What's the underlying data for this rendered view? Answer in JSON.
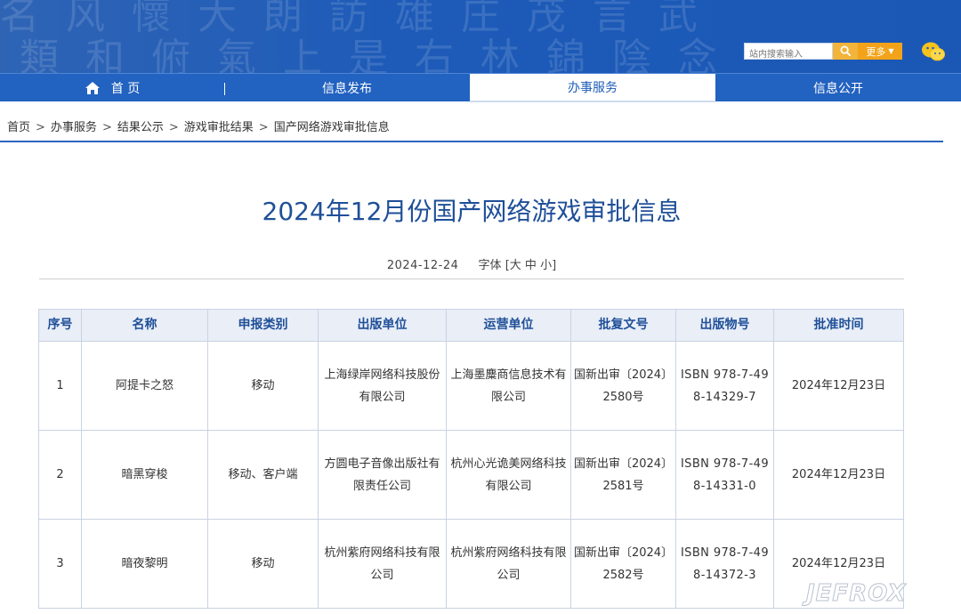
{
  "header": {
    "search_placeholder": "站内搜索输入",
    "more_label": "更多",
    "calligraphy_lines": [
      "名 风 懷 大 朗 訪 雄 庄 茂 言 武",
      "類 和 俯 氣 上 是 右 林 錦 陰 念"
    ]
  },
  "nav": {
    "items": [
      {
        "label": "首 页"
      },
      {
        "label": "信息发布"
      },
      {
        "label": "办事服务"
      },
      {
        "label": "信息公开"
      }
    ]
  },
  "breadcrumb": {
    "items": [
      "首页",
      "办事服务",
      "结果公示",
      "游戏审批结果",
      "国产网络游戏审批信息"
    ],
    "separator": ">"
  },
  "article": {
    "title": "2024年12月份国产网络游戏审批信息",
    "date": "2024-12-24",
    "font_size_label": "字体",
    "font_size_options": [
      "大",
      "中",
      "小"
    ]
  },
  "table": {
    "headers": [
      "序号",
      "名称",
      "申报类别",
      "出版单位",
      "运营单位",
      "批复文号",
      "出版物号",
      "批准时间"
    ],
    "rows": [
      {
        "no": "1",
        "name": "阿提卡之怒",
        "category": "移动",
        "publisher": "上海绿岸网络科技股份有限公司",
        "operator": "上海墨麋商信息技术有限公司",
        "approval": "国新出审〔2024〕2580号",
        "isbn": "ISBN 978-7-498-14329-7",
        "date": "2024年12月23日"
      },
      {
        "no": "2",
        "name": "暗黑穿梭",
        "category": "移动、客户端",
        "publisher": "方圆电子音像出版社有限责任公司",
        "operator": "杭州心光诡美网络科技有限公司",
        "approval": "国新出审〔2024〕2581号",
        "isbn": "ISBN 978-7-498-14331-0",
        "date": "2024年12月23日"
      },
      {
        "no": "3",
        "name": "暗夜黎明",
        "category": "移动",
        "publisher": "杭州紫府网络科技有限公司",
        "operator": "杭州紫府网络科技有限公司",
        "approval": "国新出审〔2024〕2582号",
        "isbn": "ISBN 978-7-498-14372-3",
        "date": "2024年12月23日"
      }
    ]
  },
  "watermark": "JEFROX",
  "colors": {
    "brand_blue": "#2262c0",
    "title_blue": "#1f4f98",
    "accent_orange": "#f2a31a"
  }
}
